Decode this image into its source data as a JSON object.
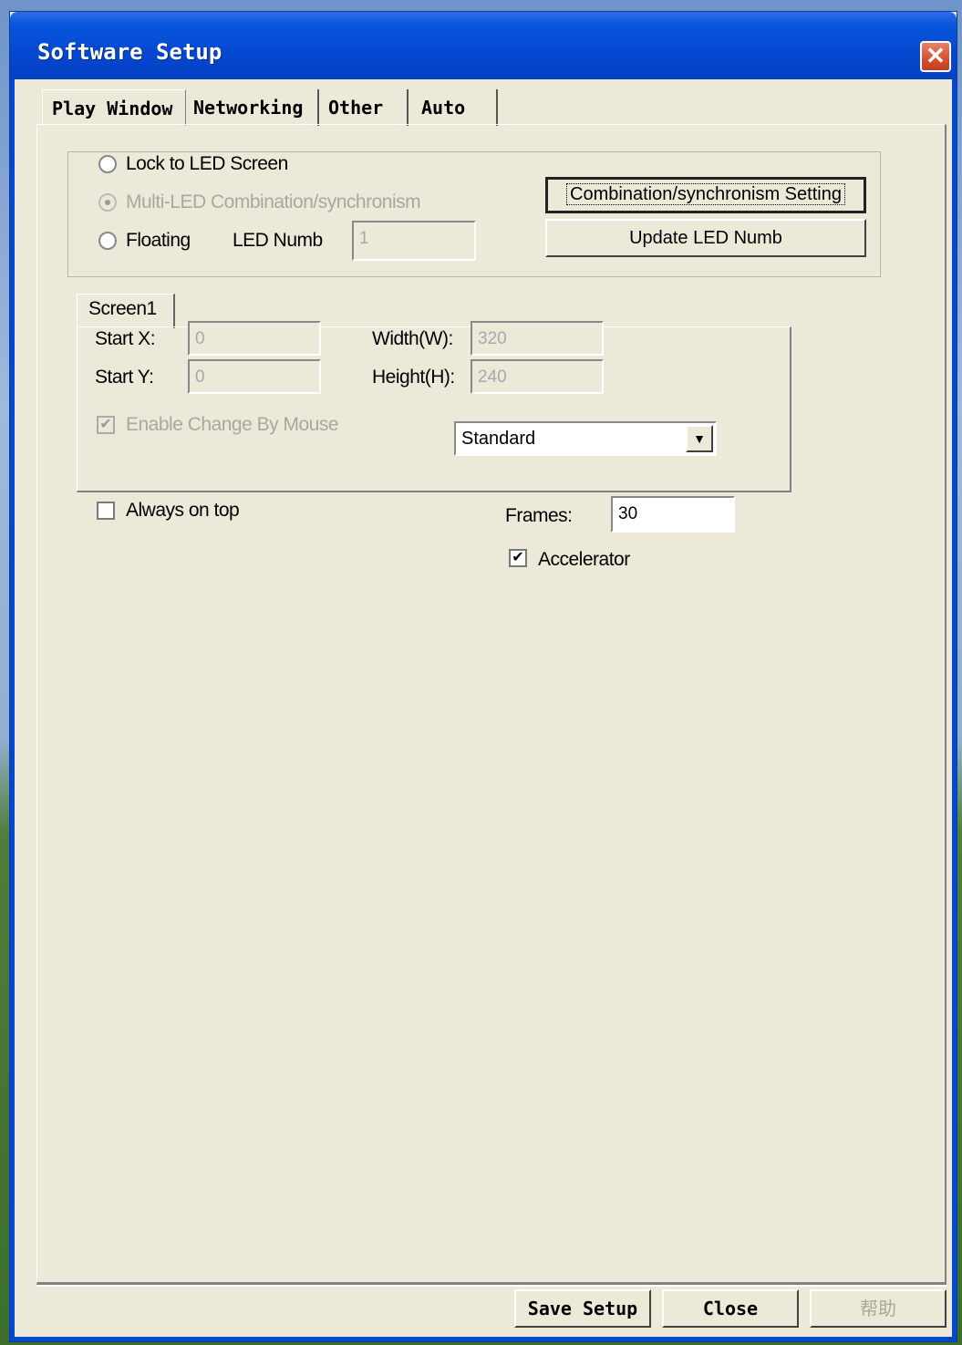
{
  "window": {
    "title": "Software Setup",
    "close_glyph": "✕"
  },
  "tabs": [
    {
      "label": "Play Window",
      "active": true
    },
    {
      "label": "Networking",
      "active": false
    },
    {
      "label": "Other",
      "active": false
    },
    {
      "label": "Auto",
      "active": false
    }
  ],
  "display_mode": {
    "options": [
      {
        "label": "Lock to LED Screen",
        "selected": false,
        "enabled": true
      },
      {
        "label": "Multi-LED Combination/synchronism",
        "selected": true,
        "enabled": false
      },
      {
        "label": "Floating",
        "selected": false,
        "enabled": true
      }
    ],
    "led_numb_label": "LED Numb",
    "led_numb_value": "1",
    "combination_button": "Combination/synchronism Setting",
    "update_button": "Update LED Numb"
  },
  "screen": {
    "tab_label": "Screen1",
    "start_x_label": "Start X:",
    "start_x_value": "0",
    "start_y_label": "Start Y:",
    "start_y_value": "0",
    "width_label": "Width(W):",
    "width_value": "320",
    "height_label": "Height(H):",
    "height_value": "240",
    "enable_change_label": "Enable Change By Mouse",
    "enable_change_checked": true,
    "mode_select_value": "Standard"
  },
  "options": {
    "always_on_top_label": "Always on top",
    "always_on_top_checked": false,
    "frames_label": "Frames:",
    "frames_value": "30",
    "accelerator_label": "Accelerator",
    "accelerator_checked": true
  },
  "footer": {
    "save_label": "Save Setup",
    "close_label": "Close",
    "help_label": "帮助"
  },
  "colors": {
    "title_bar": "#0548d0",
    "dialog_bg": "#ece9d8",
    "close_red": "#d4502e"
  }
}
